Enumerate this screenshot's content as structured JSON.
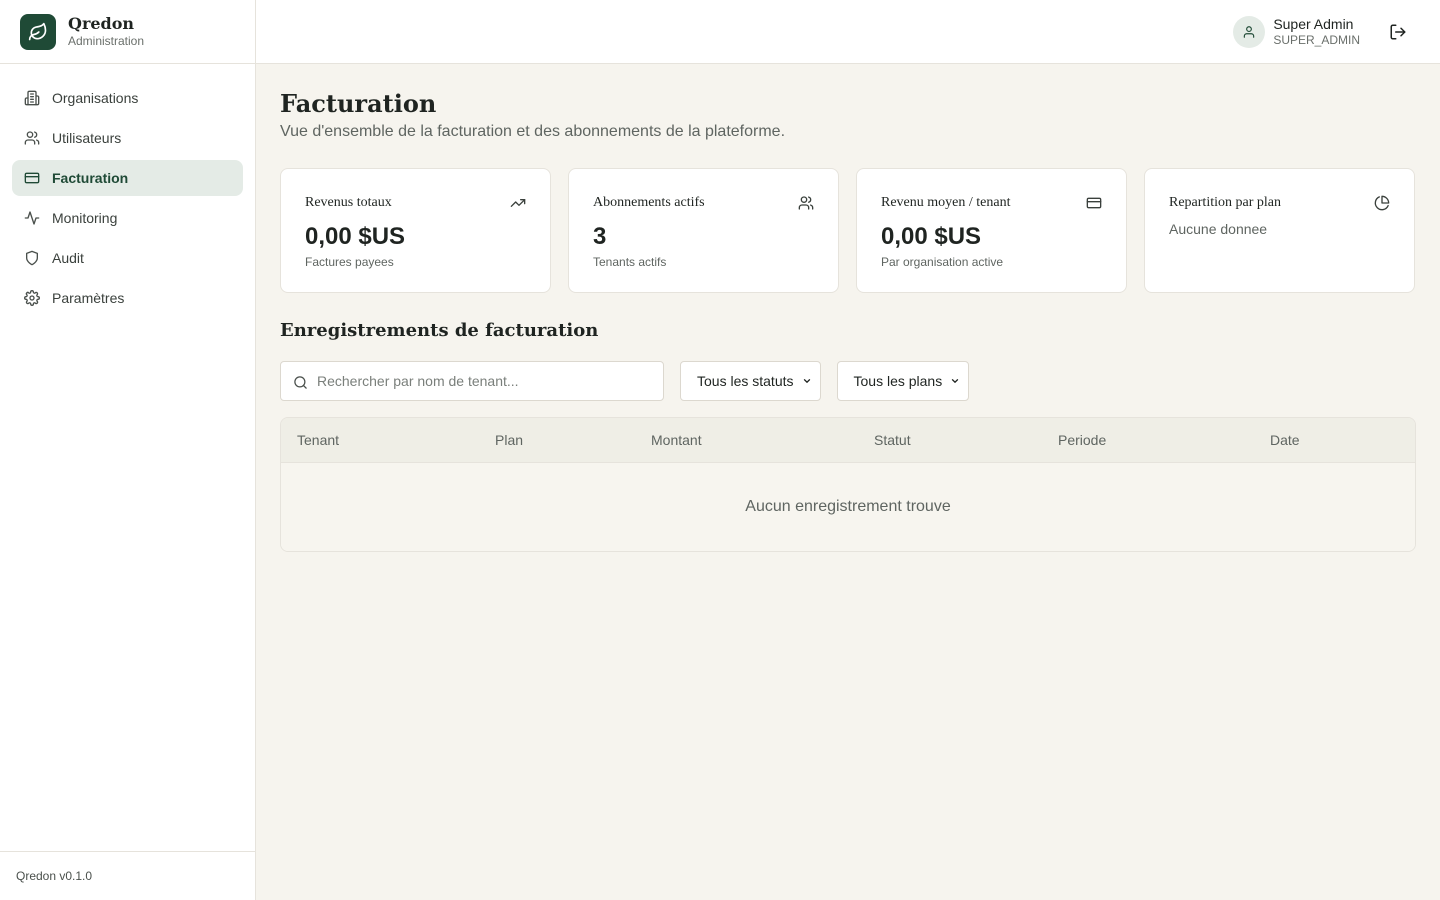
{
  "brand": {
    "name": "Qredon",
    "subtitle": "Administration"
  },
  "sidebar": {
    "items": [
      {
        "label": "Organisations",
        "icon": "building-icon"
      },
      {
        "label": "Utilisateurs",
        "icon": "users-icon"
      },
      {
        "label": "Facturation",
        "icon": "credit-card-icon",
        "active": true
      },
      {
        "label": "Monitoring",
        "icon": "activity-icon"
      },
      {
        "label": "Audit",
        "icon": "shield-icon"
      },
      {
        "label": "Paramètres",
        "icon": "gear-icon"
      }
    ],
    "footer": "Qredon v0.1.0"
  },
  "user": {
    "name": "Super Admin",
    "role": "SUPER_ADMIN"
  },
  "page": {
    "title": "Facturation",
    "subtitle": "Vue d'ensemble de la facturation et des abonnements de la plateforme."
  },
  "cards": [
    {
      "title": "Revenus totaux",
      "value": "0,00 $US",
      "sub": "Factures payees",
      "icon": "trending-up-icon"
    },
    {
      "title": "Abonnements actifs",
      "value": "3",
      "sub": "Tenants actifs",
      "icon": "users-icon"
    },
    {
      "title": "Revenu moyen / tenant",
      "value": "0,00 $US",
      "sub": "Par organisation active",
      "icon": "credit-card-icon"
    },
    {
      "title": "Repartition par plan",
      "empty": "Aucune donnee",
      "icon": "pie-chart-icon"
    }
  ],
  "records": {
    "title": "Enregistrements de facturation",
    "search_placeholder": "Rechercher par nom de tenant...",
    "status_filter": "Tous les statuts",
    "plan_filter": "Tous les plans",
    "columns": [
      "Tenant",
      "Plan",
      "Montant",
      "Statut",
      "Periode",
      "Date"
    ],
    "empty": "Aucun enregistrement trouve"
  },
  "colors": {
    "accent": "#1f4a36",
    "active_bg": "#e4ebe6",
    "background": "#f6f4ee"
  }
}
